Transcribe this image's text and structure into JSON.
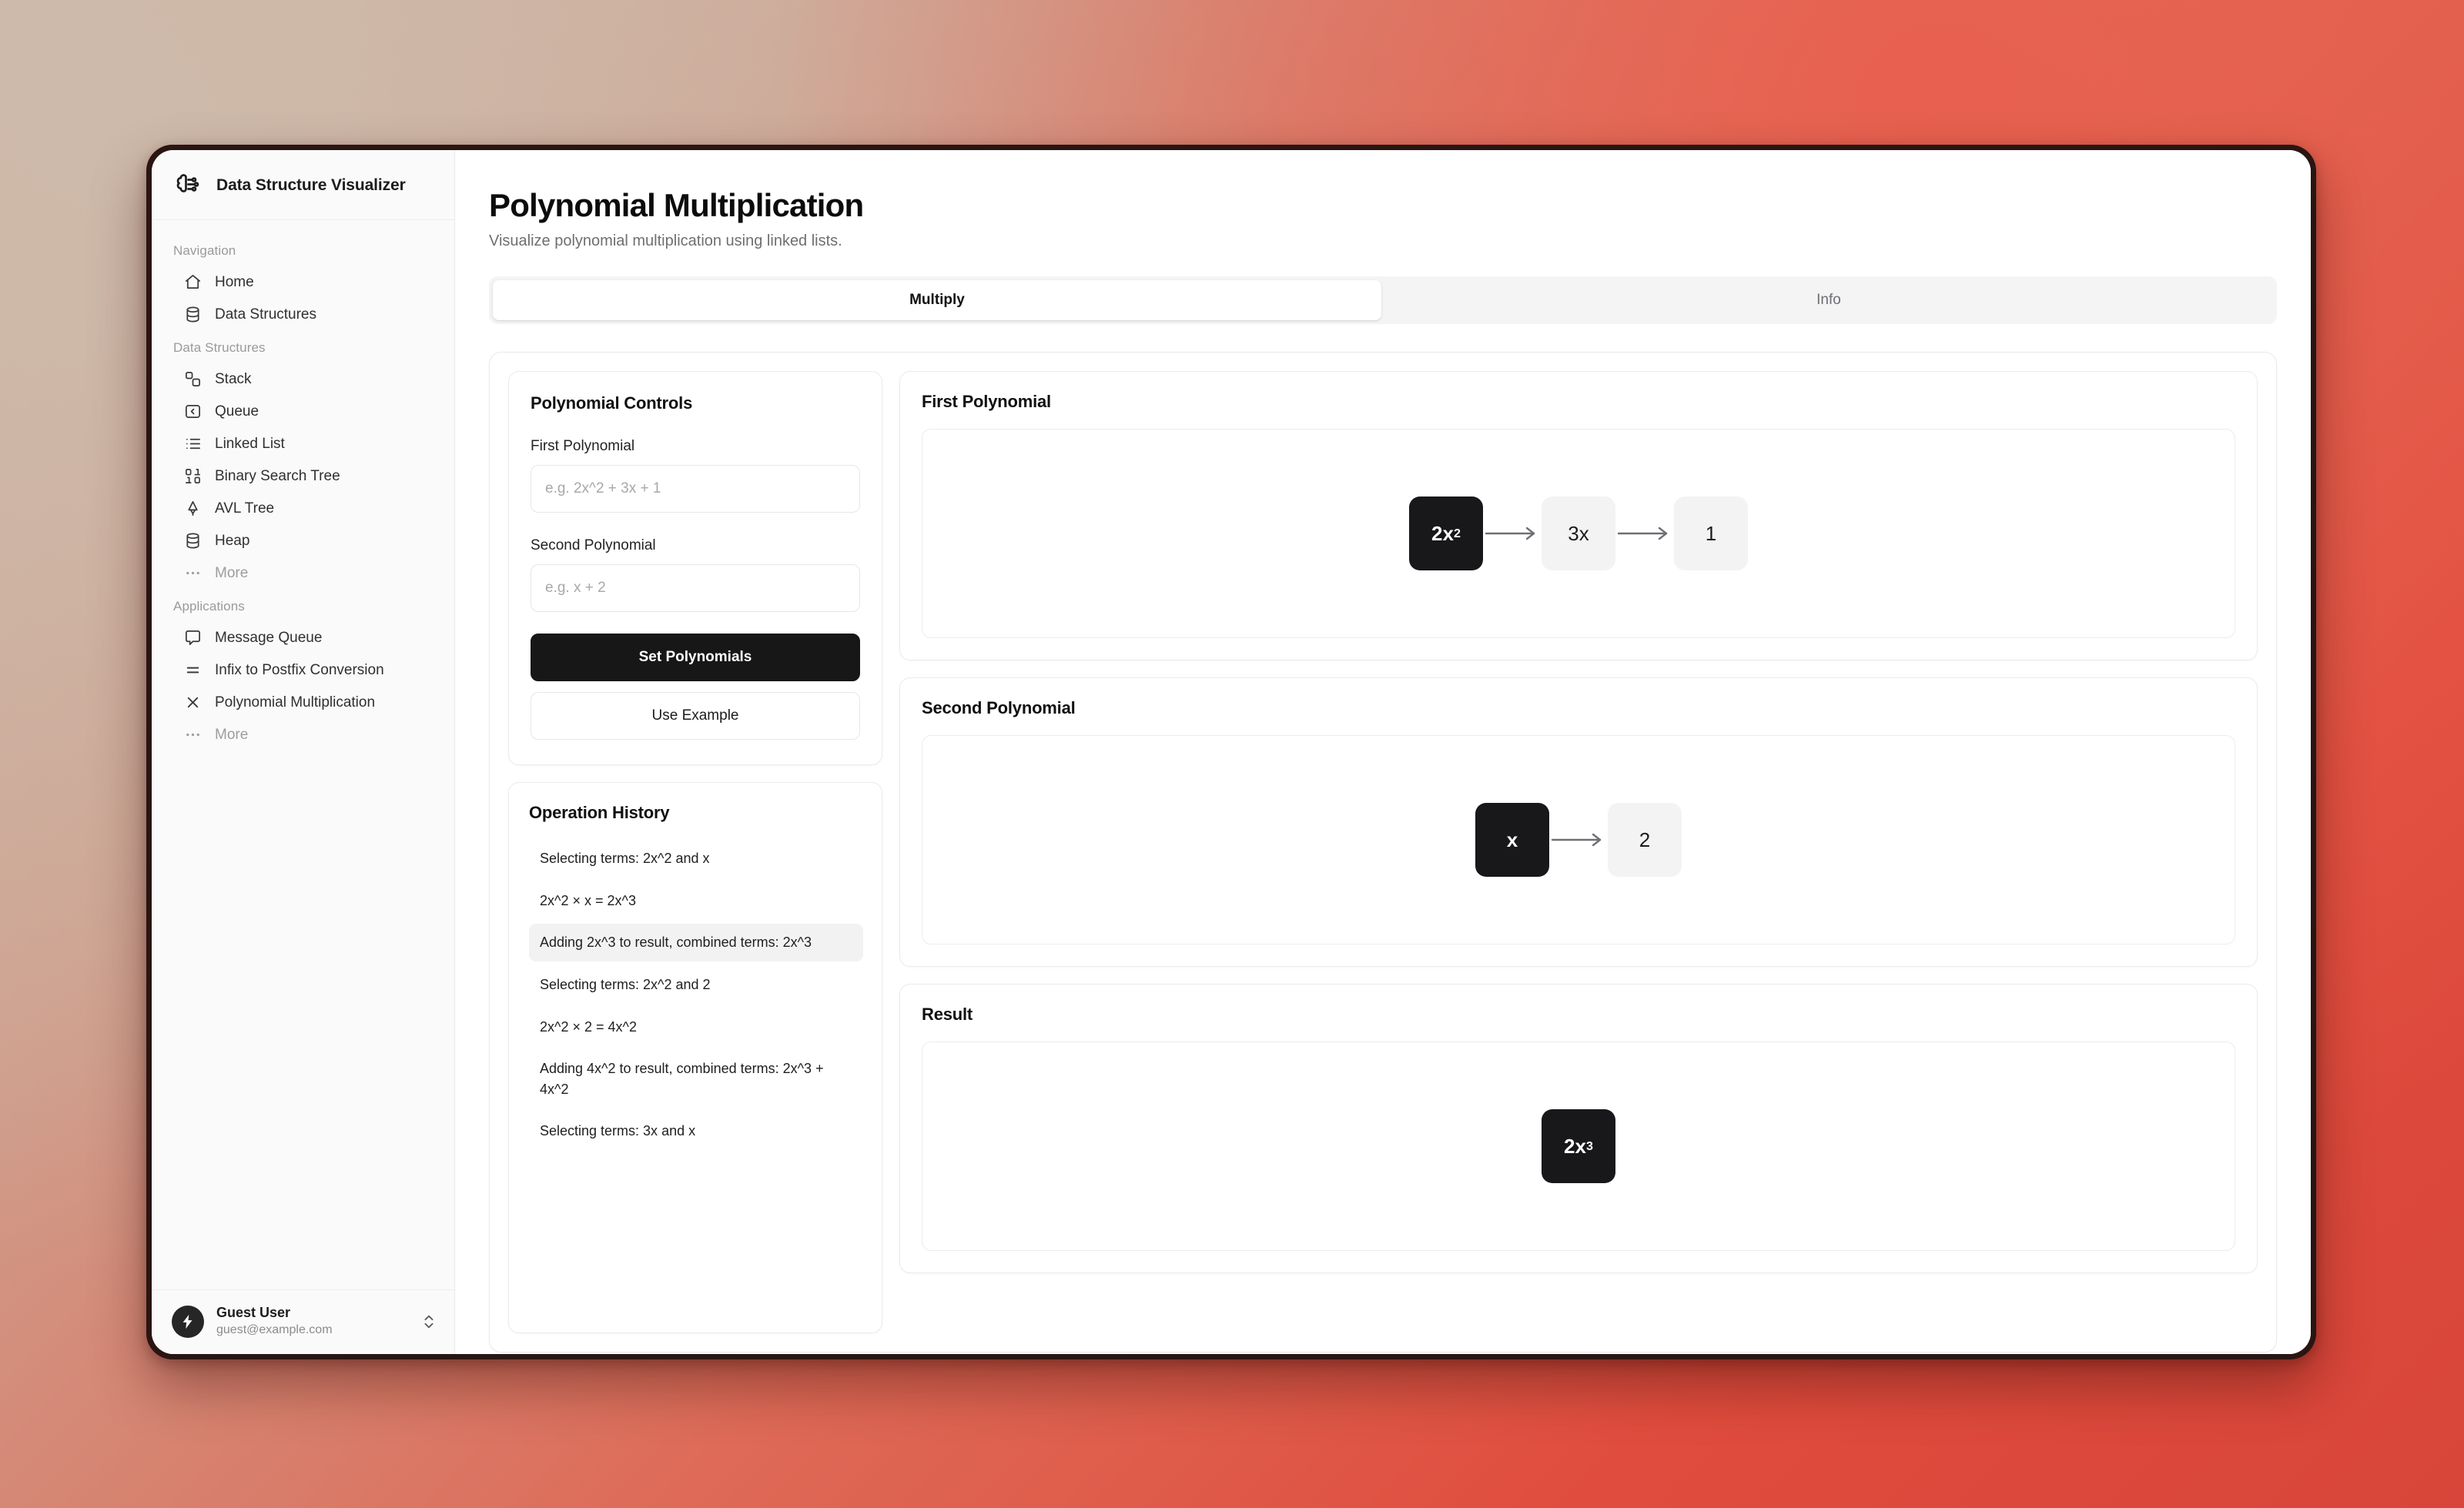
{
  "brand": {
    "title": "Data Structure Visualizer",
    "icon": "brain-circuit-icon"
  },
  "sidebar": {
    "groups": [
      {
        "label": "Navigation",
        "items": [
          {
            "label": "Home",
            "icon": "home-icon",
            "muted": false
          },
          {
            "label": "Data Structures",
            "icon": "database-icon",
            "muted": false
          }
        ]
      },
      {
        "label": "Data Structures",
        "items": [
          {
            "label": "Stack",
            "icon": "stack-squares-icon",
            "muted": false
          },
          {
            "label": "Queue",
            "icon": "queue-square-chevron-icon",
            "muted": false
          },
          {
            "label": "Linked List",
            "icon": "list-icon",
            "muted": false
          },
          {
            "label": "Binary Search Tree",
            "icon": "binary-icon",
            "muted": false
          },
          {
            "label": "AVL Tree",
            "icon": "tree-pine-icon",
            "muted": false
          },
          {
            "label": "Heap",
            "icon": "database-icon",
            "muted": false
          },
          {
            "label": "More",
            "icon": "ellipsis-icon",
            "muted": true
          }
        ]
      },
      {
        "label": "Applications",
        "items": [
          {
            "label": "Message Queue",
            "icon": "message-square-icon",
            "muted": false
          },
          {
            "label": "Infix to Postfix Conversion",
            "icon": "equals-icon",
            "muted": false
          },
          {
            "label": "Polynomial Multiplication",
            "icon": "x-icon",
            "muted": false
          },
          {
            "label": "More",
            "icon": "ellipsis-icon",
            "muted": true
          }
        ]
      }
    ],
    "footer": {
      "name": "Guest User",
      "email": "guest@example.com",
      "avatar_icon": "zap-icon",
      "chevron_icon": "chevrons-up-down-icon"
    }
  },
  "header": {
    "title": "Polynomial Multiplication",
    "subtitle": "Visualize polynomial multiplication using linked lists."
  },
  "tabs": [
    {
      "label": "Multiply",
      "active": true
    },
    {
      "label": "Info",
      "active": false
    }
  ],
  "controls": {
    "title": "Polynomial Controls",
    "first_label": "First Polynomial",
    "first_placeholder": "e.g. 2x^2 + 3x + 1",
    "first_value": "",
    "second_label": "Second Polynomial",
    "second_placeholder": "e.g. x + 2",
    "second_value": "",
    "set_button": "Set Polynomials",
    "example_button": "Use Example"
  },
  "history": {
    "title": "Operation History",
    "items": [
      {
        "text": "Selecting terms: 2x^2 and x",
        "highlight": false
      },
      {
        "text": "2x^2 × x = 2x^3",
        "highlight": false
      },
      {
        "text": "Adding 2x^3 to result, combined terms: 2x^3",
        "highlight": true
      },
      {
        "text": "Selecting terms: 2x^2 and 2",
        "highlight": false
      },
      {
        "text": "2x^2 × 2 = 4x^2",
        "highlight": false
      },
      {
        "text": "Adding 4x^2 to result, combined terms: 2x^3 + 4x^2",
        "highlight": false
      },
      {
        "text": "Selecting terms: 3x and x",
        "highlight": false
      }
    ]
  },
  "visualizations": [
    {
      "title": "First Polynomial",
      "nodes": [
        {
          "base": "2x",
          "exp": "2",
          "state": "dark"
        },
        {
          "base": "3x",
          "exp": "",
          "state": "light"
        },
        {
          "base": "1",
          "exp": "",
          "state": "light"
        }
      ]
    },
    {
      "title": "Second Polynomial",
      "nodes": [
        {
          "base": "x",
          "exp": "",
          "state": "dark"
        },
        {
          "base": "2",
          "exp": "",
          "state": "light"
        }
      ]
    },
    {
      "title": "Result",
      "nodes": [
        {
          "base": "2x",
          "exp": "3",
          "state": "dark"
        }
      ]
    }
  ],
  "colors": {
    "accent_dark": "#18181b",
    "node_light": "#f3f3f4",
    "tab_track": "#f4f4f5",
    "highlight_row": "#f2f2f3",
    "frame": "#2a1512"
  }
}
